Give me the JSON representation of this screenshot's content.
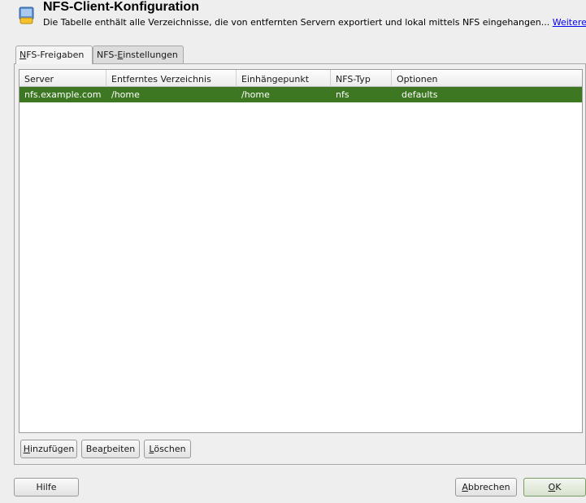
{
  "header": {
    "title": "NFS-Client-Konfiguration",
    "description": "Die Tabelle enthält alle Verzeichnisse, die von entfernten Servern exportiert und lokal mittels NFS eingehangen...",
    "more_link": "Weitere",
    "icon": "nfs-config-icon"
  },
  "tabs": [
    {
      "pre": "",
      "key": "N",
      "post": "FS-Freigaben",
      "active": true
    },
    {
      "pre": "NFS-",
      "key": "E",
      "post": "instellungen",
      "active": false
    }
  ],
  "table": {
    "columns": [
      "Server",
      "Entferntes Verzeichnis",
      "Einhängepunkt",
      "NFS-Typ",
      "Optionen"
    ],
    "rows": [
      {
        "server": "nfs.example.com",
        "remote_dir": "/home",
        "mount_point": "/home",
        "nfs_type": "nfs",
        "options": "defaults"
      }
    ],
    "selected_row_color": "#3d7721"
  },
  "actions": {
    "add": {
      "pre": "",
      "key": "H",
      "post": "inzufügen"
    },
    "edit": {
      "pre": "Bea",
      "key": "r",
      "post": "beiten"
    },
    "delete": {
      "pre": "",
      "key": "L",
      "post": "öschen"
    }
  },
  "footer": {
    "help": "Hilfe",
    "cancel": {
      "pre": "",
      "key": "A",
      "post": "bbrechen"
    },
    "ok": {
      "pre": "",
      "key": "O",
      "post": "K"
    }
  }
}
